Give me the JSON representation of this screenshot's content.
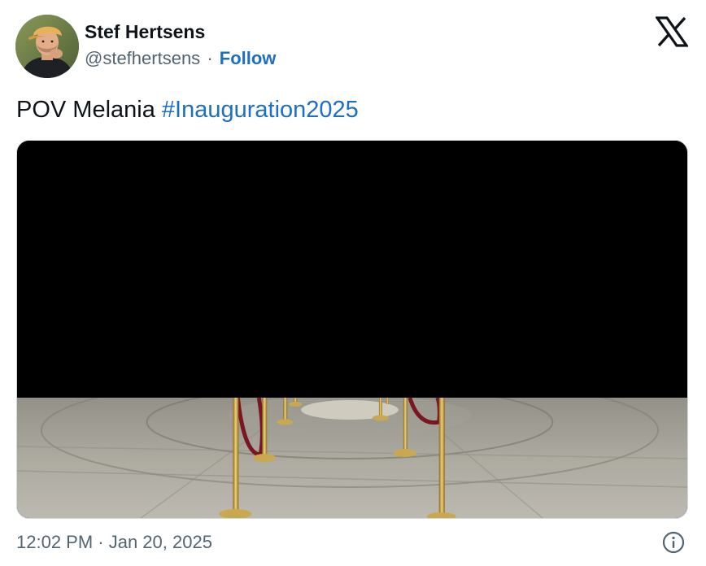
{
  "author": {
    "display_name": "Stef Hertsens",
    "handle": "@stefhertsens",
    "separator": "·",
    "follow_label": "Follow",
    "avatar_icon": "user-avatar"
  },
  "platform": {
    "logo_icon": "x-logo-icon"
  },
  "tweet": {
    "text": "POV Melania ",
    "hashtag": "#Inauguration2025",
    "hashtag_color": "#1d6fbf"
  },
  "media": {
    "type": "video-thumbnail"
  },
  "footer": {
    "timestamp": "12:02 PM · Jan 20, 2025",
    "info_icon": "info-icon"
  },
  "colors": {
    "text_primary": "#0f1419",
    "text_secondary": "#536471",
    "link": "#1d6fbf"
  }
}
